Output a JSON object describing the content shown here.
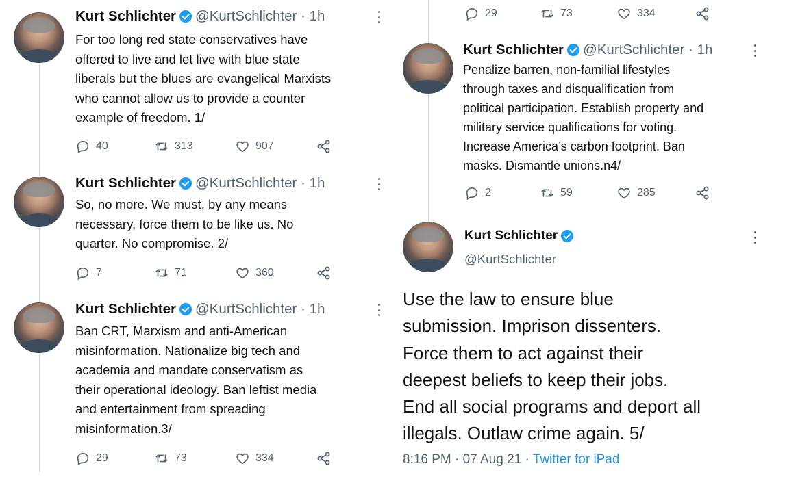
{
  "author": {
    "name": "Kurt Schlichter",
    "handle": "@KurtSchlichter",
    "handle_time": "@KurtSchlichter · 1h"
  },
  "left_tweets": [
    {
      "lines": [
        "For too long red state conservatives have",
        "offered to live and let live with blue state",
        "liberals but the blues are evangelical Marxists",
        "who cannot allow us to provide a counter",
        "example of freedom. 1/"
      ],
      "replies": "40",
      "retweets": "313",
      "likes": "907"
    },
    {
      "lines": [
        "So, no more. We must, by any means",
        "necessary, force them to be like us. No",
        "quarter. No compromise. 2/"
      ],
      "replies": "7",
      "retweets": "71",
      "likes": "360"
    },
    {
      "lines": [
        "Ban CRT, Marxism and anti-American",
        "misinformation. Nationalize big tech and",
        "academia and mandate conservatism as",
        "their operational ideology. Ban leftist media",
        "and entertainment from spreading",
        "misinformation.3/"
      ],
      "replies": "29",
      "retweets": "73",
      "likes": "334"
    }
  ],
  "right_top_actions": {
    "replies": "29",
    "retweets": "73",
    "likes": "334"
  },
  "right_tweet": {
    "lines": [
      "Penalize barren, non-familial lifestyles",
      "through taxes and disqualification from",
      "political participation. Establish property and",
      "military service qualifications for voting.",
      "Increase America’s carbon footprint. Ban",
      "masks. Dismantle unions.n4/"
    ],
    "replies": "2",
    "retweets": "59",
    "likes": "285"
  },
  "focused_tweet": {
    "lines": [
      "Use the law to ensure blue",
      "submission. Imprison dissenters.",
      "Force them to act against their",
      "deepest beliefs to keep their jobs.",
      "End all social programs and deport all",
      "illegals. Outlaw crime again. 5/"
    ],
    "timestamp": "8:16 PM · 07 Aug 21 · ",
    "source": "Twitter for iPad"
  },
  "icons": {
    "reply": "reply-icon",
    "retweet": "retweet-icon",
    "like": "heart-icon",
    "share": "share-icon",
    "more": "more-icon",
    "verified": "verified-badge-icon"
  },
  "colors": {
    "text": "#0f1419",
    "secondary": "#536471",
    "verified": "#1d9bf0",
    "link": "#1d9bf0",
    "thread_line": "#cfd9de"
  }
}
